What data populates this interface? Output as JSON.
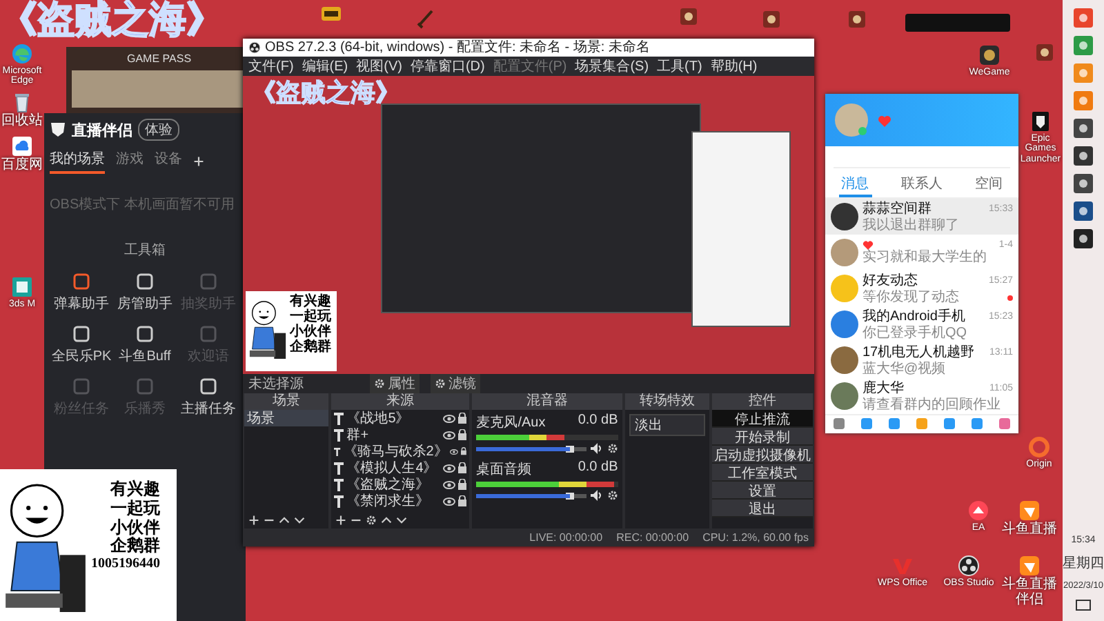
{
  "overlay_title": "《盗贼之海》",
  "desktop_icons": [
    {
      "kind": "edge",
      "label": "Microsoft Edge"
    },
    {
      "kind": "recycle",
      "label": "回收站"
    },
    {
      "kind": "baidu",
      "label": "百度网"
    },
    {
      "kind": "max3d",
      "label": "3ds M"
    },
    {
      "kind": "pubg"
    },
    {
      "kind": "sword"
    },
    {
      "kind": "app"
    },
    {
      "kind": "app"
    },
    {
      "kind": "app"
    },
    {
      "kind": "wegame",
      "label": "WeGame"
    },
    {
      "kind": "app"
    },
    {
      "kind": "epic",
      "label": "Epic Games Launcher"
    },
    {
      "kind": "origin",
      "label": "Origin"
    },
    {
      "kind": "ea",
      "label": "EA"
    },
    {
      "kind": "douyu",
      "label": "斗鱼直播"
    },
    {
      "kind": "wps",
      "label": "WPS Office"
    },
    {
      "kind": "obs",
      "label": "OBS Studio"
    },
    {
      "kind": "douyu",
      "label": "斗鱼直播伴侣"
    }
  ],
  "taskbar": {
    "time": "15:34",
    "weekday": "星期四",
    "date": "2022/3/10"
  },
  "gamepass": {
    "title": "GAME PASS"
  },
  "companion": {
    "brand": "直播伴侣",
    "badge": "体验",
    "tabs": [
      {
        "label": "我的场景",
        "selected": true
      },
      {
        "label": "游戏",
        "selected": false
      },
      {
        "label": "设备",
        "selected": false
      }
    ],
    "notice": "OBS模式下 本机画面暂不可用",
    "toolbox_title": "工具箱",
    "tools": [
      {
        "label": "弹幕助手",
        "disabled": false
      },
      {
        "label": "房管助手",
        "disabled": false
      },
      {
        "label": "抽奖助手",
        "disabled": true
      },
      {
        "label": "全民乐PK",
        "disabled": false
      },
      {
        "label": "斗鱼Buff",
        "disabled": false
      },
      {
        "label": "欢迎语",
        "disabled": true
      },
      {
        "label": "粉丝任务",
        "disabled": true
      },
      {
        "label": "乐播秀",
        "disabled": true
      },
      {
        "label": "主播任务",
        "disabled": false
      }
    ]
  },
  "obs": {
    "title": "OBS 27.2.3 (64-bit, windows) - 配置文件: 未命名 - 场景: 未命名",
    "menu": [
      {
        "label": "文件(F)",
        "disabled": false
      },
      {
        "label": "编辑(E)",
        "disabled": false
      },
      {
        "label": "视图(V)",
        "disabled": false
      },
      {
        "label": "停靠窗口(D)",
        "disabled": false
      },
      {
        "label": "配置文件(P)",
        "disabled": true
      },
      {
        "label": "场景集合(S)",
        "disabled": false
      },
      {
        "label": "工具(T)",
        "disabled": false
      },
      {
        "label": "帮助(H)",
        "disabled": false
      }
    ],
    "preview": {
      "title": "《盗贼之海》",
      "meme_lines": [
        "有兴趣",
        "一起玩",
        "小伙伴",
        "企鹅群"
      ]
    },
    "source_bar": {
      "label": "未选择源",
      "buttons": [
        "属性",
        "滤镜"
      ]
    },
    "scenes": {
      "title": "场景",
      "items": [
        {
          "label": "场景",
          "selected": true
        }
      ]
    },
    "sources": {
      "title": "来源",
      "items": [
        {
          "label": "《战地5》",
          "visible": true
        },
        {
          "label": "群+",
          "visible": true
        },
        {
          "label": "《骑马与砍杀2》",
          "visible": true
        },
        {
          "label": "《模拟人生4》",
          "visible": true
        },
        {
          "label": "《盗贼之海》",
          "visible": true
        },
        {
          "label": "《禁闭求生》",
          "visible": true
        }
      ]
    },
    "mixer": {
      "title": "混音器",
      "channels": [
        {
          "name": "麦克风/Aux",
          "reading": "0.0 dB",
          "level": 0.62,
          "volume": {
            "level": 0.85
          }
        },
        {
          "name": "桌面音频",
          "reading": "0.0 dB",
          "level": 0.97,
          "volume": {
            "level": 0.85
          }
        }
      ]
    },
    "transitions": {
      "title": "转场特效",
      "value": "淡出"
    },
    "controls": {
      "title": "控件",
      "buttons": [
        {
          "label": "停止推流",
          "active": true
        },
        {
          "label": "开始录制",
          "active": false
        },
        {
          "label": "启动虚拟摄像机",
          "active": false
        },
        {
          "label": "工作室模式",
          "active": false
        },
        {
          "label": "设置",
          "active": false
        },
        {
          "label": "退出",
          "active": false
        }
      ]
    },
    "status": {
      "live": "LIVE: 00:00:00",
      "rec": "REC: 00:00:00",
      "cpu": "CPU: 1.2%, 60.00 fps"
    }
  },
  "qq": {
    "tabs": [
      {
        "label": "消息",
        "selected": true
      },
      {
        "label": "联系人",
        "selected": false
      },
      {
        "label": "空间",
        "selected": false
      }
    ],
    "chats": [
      {
        "name": "蒜蒜空间群",
        "time": "15:33",
        "preview": "我以退出群聊了",
        "selected": true,
        "unread": false
      },
      {
        "time": "1-4",
        "preview": "实习就和最大学生的",
        "selected": false,
        "unread": false
      },
      {
        "name": "好友动态",
        "time": "15:27",
        "preview": "等你发现了动态",
        "selected": false,
        "unread": true
      },
      {
        "name": "我的Android手机",
        "time": "15:23",
        "preview": "你已登录手机QQ",
        "selected": false,
        "unread": false
      },
      {
        "name": "17机电无人机越野",
        "time": "13:11",
        "preview": "蓝大华@视频",
        "selected": false,
        "unread": false
      },
      {
        "name": "鹿大华",
        "time": "11:05",
        "preview": "请查看群内的回顾作业",
        "selected": false,
        "unread": false
      }
    ]
  },
  "meme": {
    "lines": [
      "有兴趣",
      "一起玩",
      "小伙伴",
      "企鹅群",
      "1005196440"
    ]
  }
}
